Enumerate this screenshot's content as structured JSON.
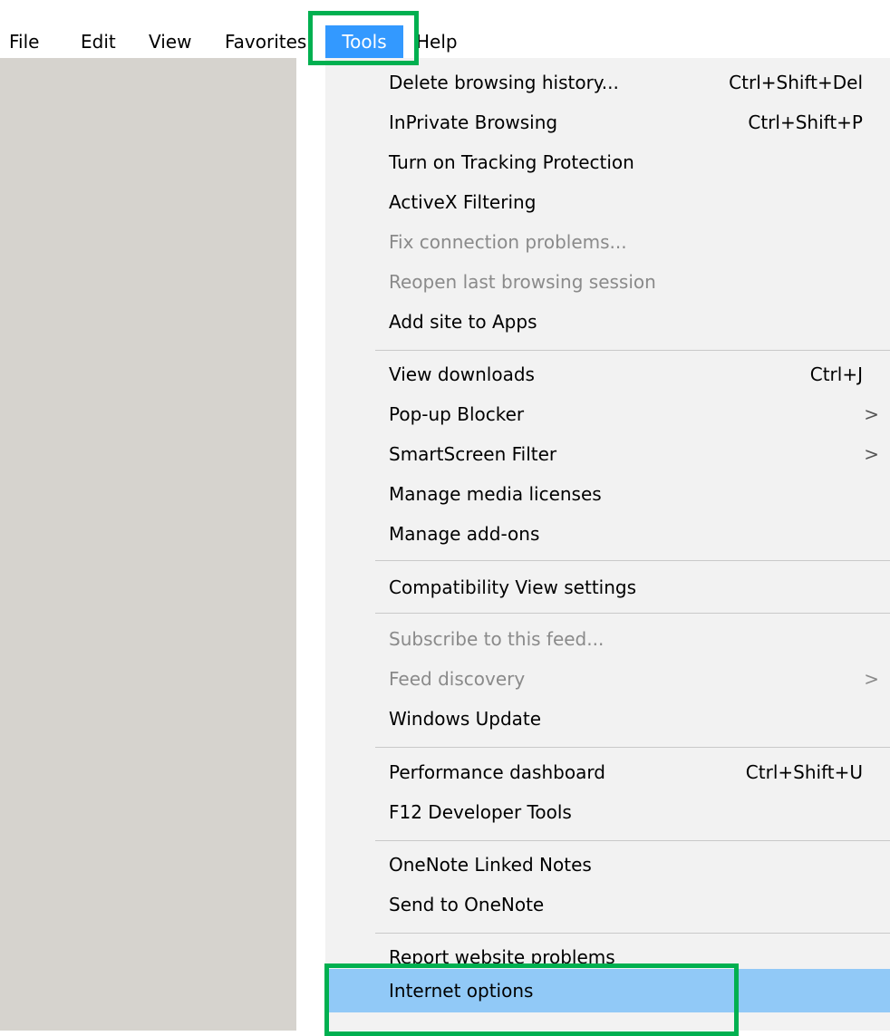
{
  "menubar": {
    "items": [
      {
        "label": "File"
      },
      {
        "label": "Edit"
      },
      {
        "label": "View"
      },
      {
        "label": "Favorites"
      },
      {
        "label": "Tools",
        "active": true
      },
      {
        "label": "Help"
      }
    ]
  },
  "tools_menu": {
    "items": [
      {
        "label": "Delete browsing history...",
        "shortcut": "Ctrl+Shift+Del"
      },
      {
        "label": "InPrivate Browsing",
        "shortcut": "Ctrl+Shift+P"
      },
      {
        "label": "Turn on Tracking Protection"
      },
      {
        "label": "ActiveX Filtering"
      },
      {
        "label": "Fix connection problems...",
        "disabled": true
      },
      {
        "label": "Reopen last browsing session",
        "disabled": true
      },
      {
        "label": "Add site to Apps"
      },
      {
        "label": "View downloads",
        "shortcut": "Ctrl+J"
      },
      {
        "label": "Pop-up Blocker",
        "submenu": true
      },
      {
        "label": "SmartScreen Filter",
        "submenu": true
      },
      {
        "label": "Manage media licenses"
      },
      {
        "label": "Manage add-ons"
      },
      {
        "label": "Compatibility View settings"
      },
      {
        "label": "Subscribe to this feed...",
        "disabled": true
      },
      {
        "label": "Feed discovery",
        "disabled": true,
        "submenu": true
      },
      {
        "label": "Windows Update"
      },
      {
        "label": "Performance dashboard",
        "shortcut": "Ctrl+Shift+U"
      },
      {
        "label": "F12 Developer Tools"
      },
      {
        "label": "OneNote Linked Notes"
      },
      {
        "label": "Send to OneNote"
      },
      {
        "label": "Report website problems"
      },
      {
        "label": "Internet options",
        "selected": true
      }
    ],
    "submenu_arrow": ">"
  },
  "colors": {
    "menubar_active_bg": "#3399ff",
    "highlight_box": "#00b050",
    "menu_bg": "#f2f2f2",
    "menu_selected_bg": "#91c9f7",
    "left_panel_bg": "#d6d3ce",
    "disabled_text": "#8a8a8a"
  }
}
